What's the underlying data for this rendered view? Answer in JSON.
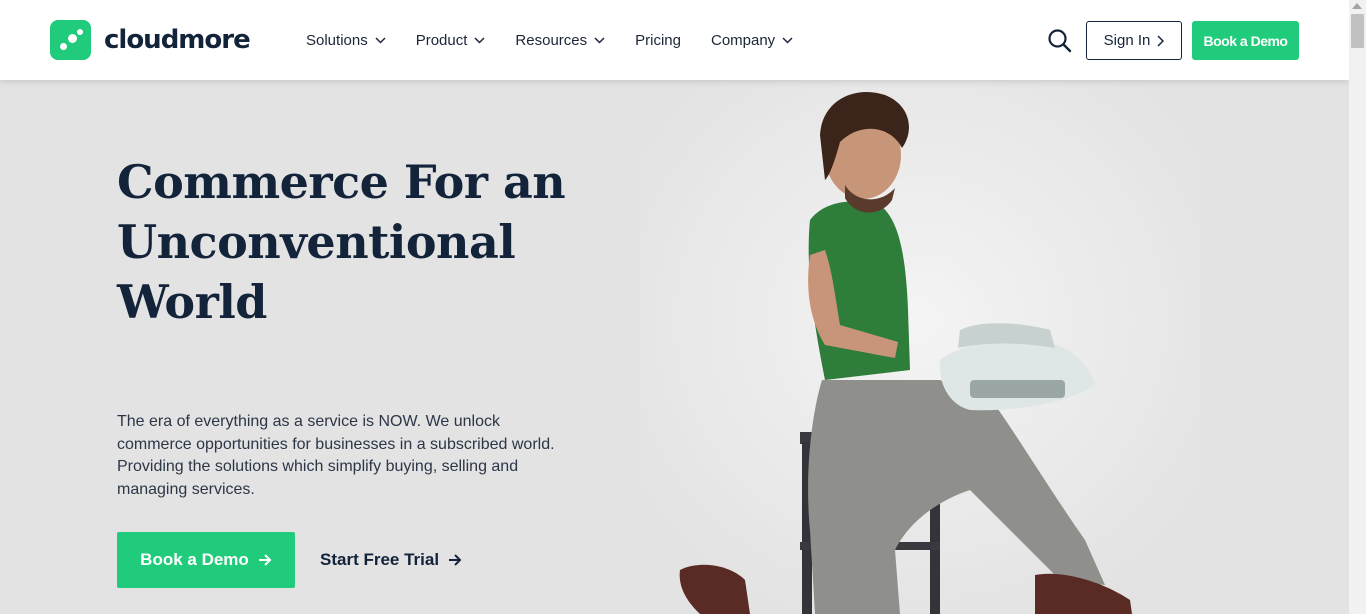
{
  "header": {
    "logo_text": "cloudmore",
    "nav": [
      {
        "label": "Solutions",
        "has_dropdown": true
      },
      {
        "label": "Product",
        "has_dropdown": true
      },
      {
        "label": "Resources",
        "has_dropdown": true
      },
      {
        "label": "Pricing",
        "has_dropdown": false
      },
      {
        "label": "Company",
        "has_dropdown": true
      }
    ],
    "search_icon": "search-icon",
    "signin_label": "Sign In",
    "demo_label": "Book a Demo"
  },
  "hero": {
    "title_lines": [
      "Commerce For an",
      "Unconventional",
      "World"
    ],
    "description": "The era of everything as a service is NOW. We unlock commerce opportunities for businesses in a subscribed world. Providing the solutions which simplify buying, selling and managing services.",
    "primary_cta": "Book a Demo",
    "secondary_cta": "Start Free Trial"
  },
  "colors": {
    "brand_green": "#20cb7b",
    "navy": "#12233a",
    "hero_bg": "#e3e3e3"
  }
}
